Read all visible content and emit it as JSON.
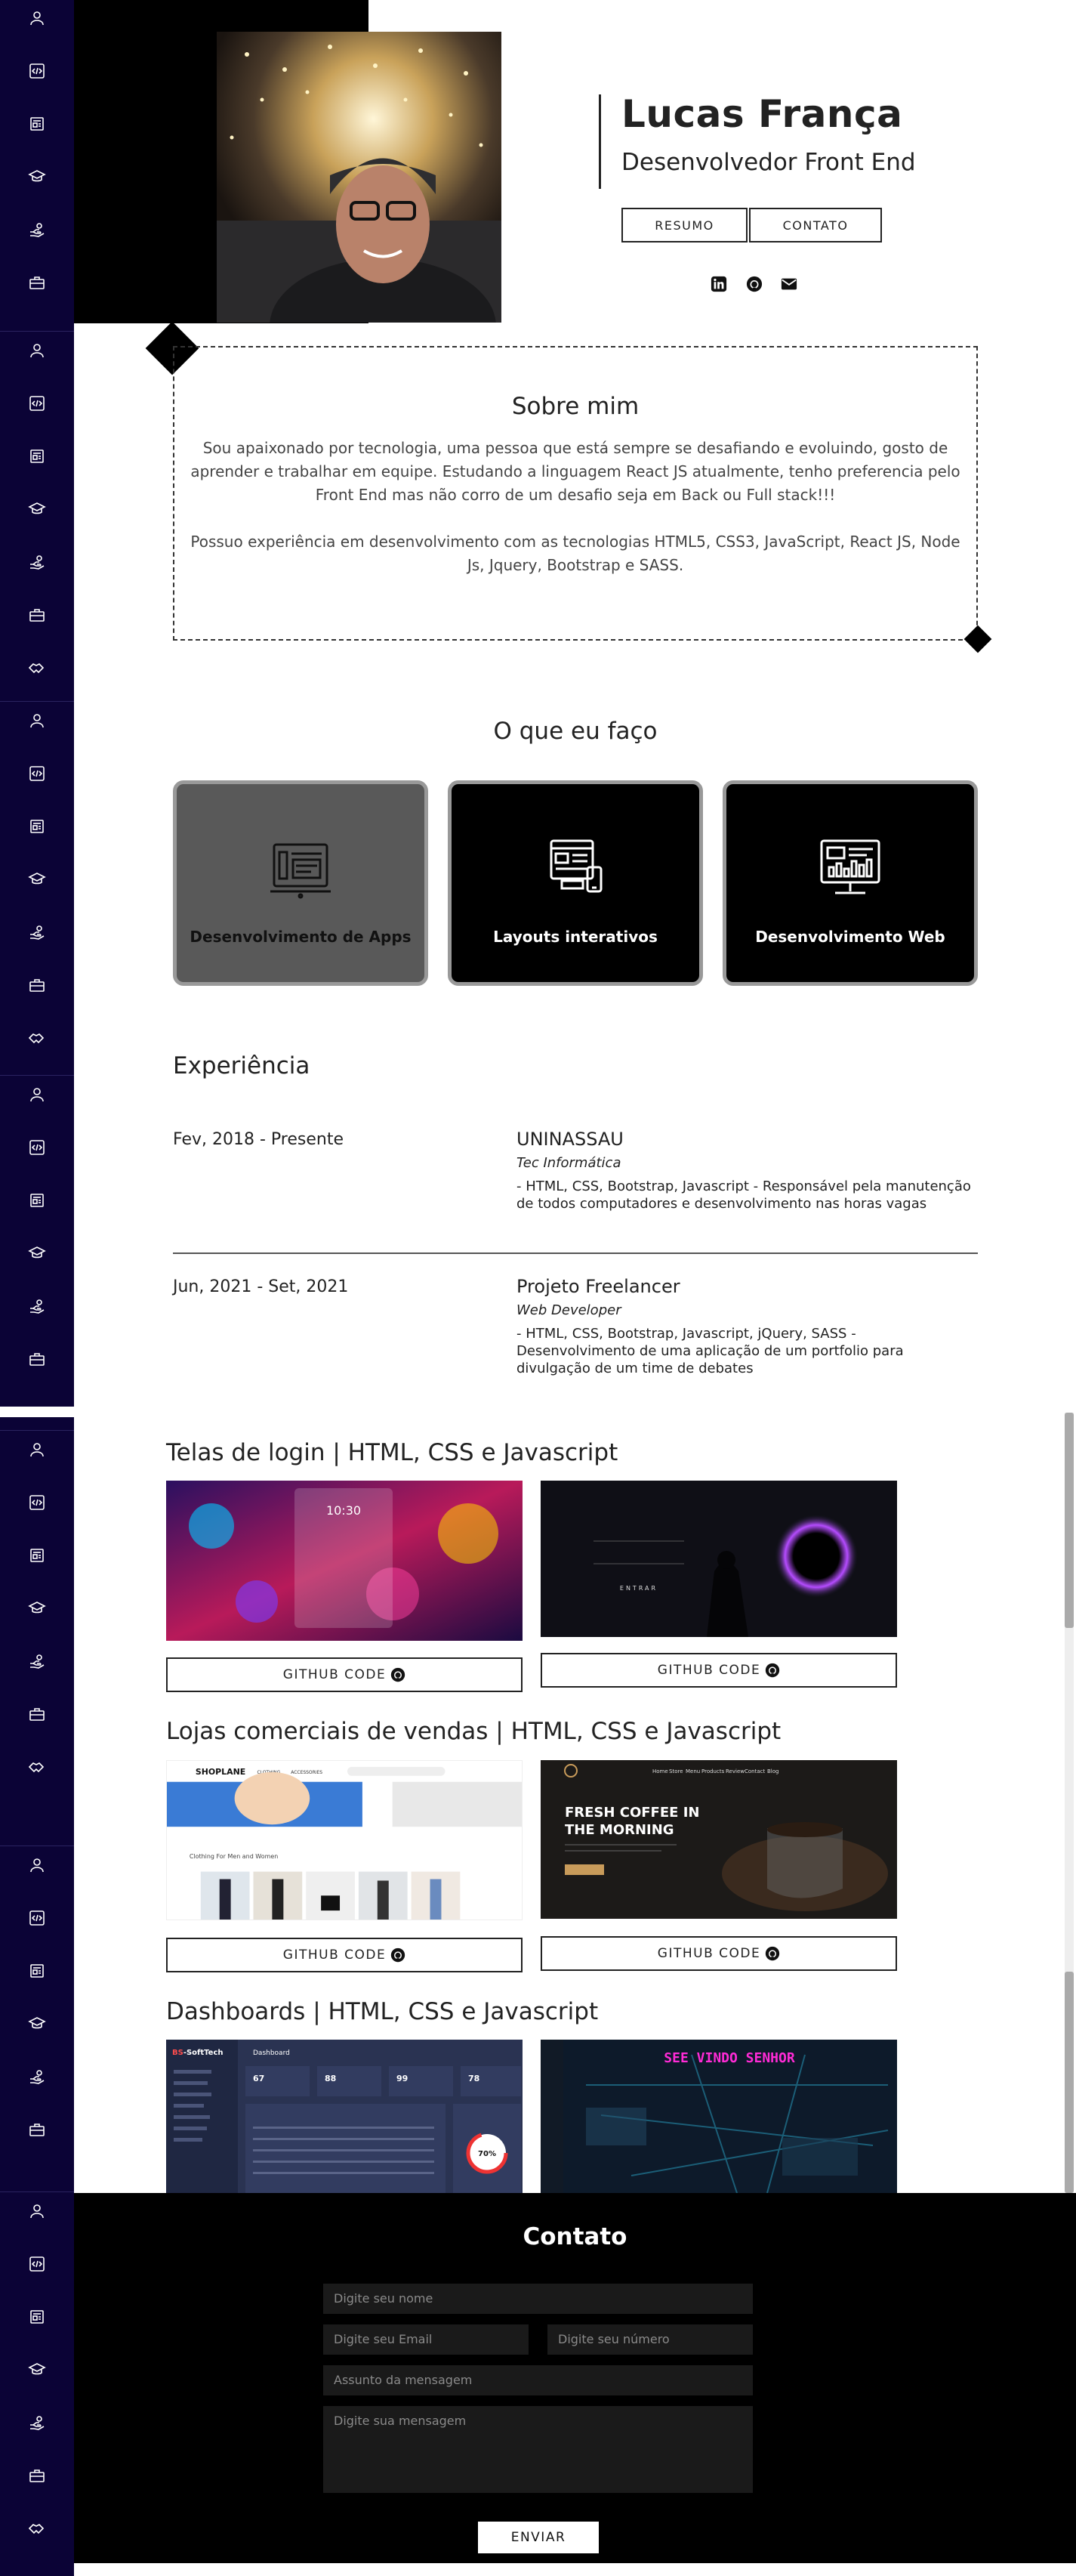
{
  "sidebar": {
    "icons": [
      "user-icon",
      "code-icon",
      "newspaper-icon",
      "graduation-cap-icon",
      "hand-coin-icon",
      "briefcase-icon",
      "handshake-icon"
    ]
  },
  "header": {
    "name": "Lucas França",
    "role": "Desenvolvedor Front End",
    "resume_label": "RESUMO",
    "contact_label": "CONTATO",
    "social": [
      "linkedin-icon",
      "github-icon",
      "mail-icon"
    ]
  },
  "about": {
    "title": "Sobre mim",
    "paragraph1": "Sou apaixonado por tecnologia, uma pessoa que está sempre se desafiando e evoluindo, gosto de aprender e trabalhar em equipe. Estudando a linguagem React JS atualmente, tenho preferencia pelo Front End mas não corro de um desafio seja em Back ou Full stack!!!",
    "paragraph2": "Possuo experiência em desenvolvimento com as tecnologias HTML5, CSS3, JavaScript, React JS, Node Js, Jquery, Bootstrap e SASS."
  },
  "services": {
    "title": "O que eu faço",
    "items": [
      {
        "label": "Desenvolvimento de Apps",
        "icon": "app-dev-icon"
      },
      {
        "label": "Layouts interativos",
        "icon": "responsive-layout-icon"
      },
      {
        "label": "Desenvolvimento Web",
        "icon": "web-dev-icon"
      }
    ]
  },
  "experience": {
    "title": "Experiência",
    "items": [
      {
        "date": "Fev, 2018 - Presente",
        "org": "UNINASSAU",
        "role": "Tec Informática",
        "desc": "- HTML, CSS, Bootstrap, Javascript - Responsável pela manutenção de todos computadores e desenvolvimento nas horas vagas"
      },
      {
        "date": "Jun, 2021 - Set, 2021",
        "org": "Projeto Freelancer",
        "role": "Web Developer",
        "desc": "- HTML, CSS, Bootstrap, Javascript, jQuery, SASS - Desenvolvimento de uma aplicação de um portfolio para divulgação de um time de debates"
      }
    ]
  },
  "projects": {
    "github_label": "GITHUB CODE",
    "groups": [
      {
        "title": "Telas de login | HTML, CSS e Javascript"
      },
      {
        "title": "Lojas comerciais de vendas | HTML, CSS e Javascript"
      },
      {
        "title": "Dashboards | HTML, CSS e Javascript"
      }
    ],
    "shop1": {
      "brand": "SHOPLANE",
      "nav1": "CLOTHING",
      "nav2": "ACCESSORIES",
      "section": "Clothing For Men and Women"
    },
    "shop2": {
      "headline1": "FRESH COFFEE IN",
      "headline2": "THE MORNING",
      "nav": [
        "Home",
        "Store",
        "Menu",
        "Products",
        "Review",
        "Contact",
        "Blog"
      ]
    },
    "dash1": {
      "brand_prefix": "BS",
      "brand": "-SoftTech",
      "header": "Dashboard",
      "stats": [
        "67",
        "88",
        "99",
        "78"
      ],
      "gauge": "70%"
    },
    "dash2": {
      "title": "SEE VINDO SENHOR"
    },
    "login1": {
      "time": "10:30"
    },
    "login2": {
      "label": "ENTRAR"
    }
  },
  "contact": {
    "title": "Contato",
    "name_placeholder": "Digite seu nome",
    "email_placeholder": "Digite seu Email",
    "phone_placeholder": "Digite seu número",
    "subject_placeholder": "Assunto da mensagem",
    "message_placeholder": "Digite sua mensagem",
    "send_label": "ENVIAR"
  }
}
